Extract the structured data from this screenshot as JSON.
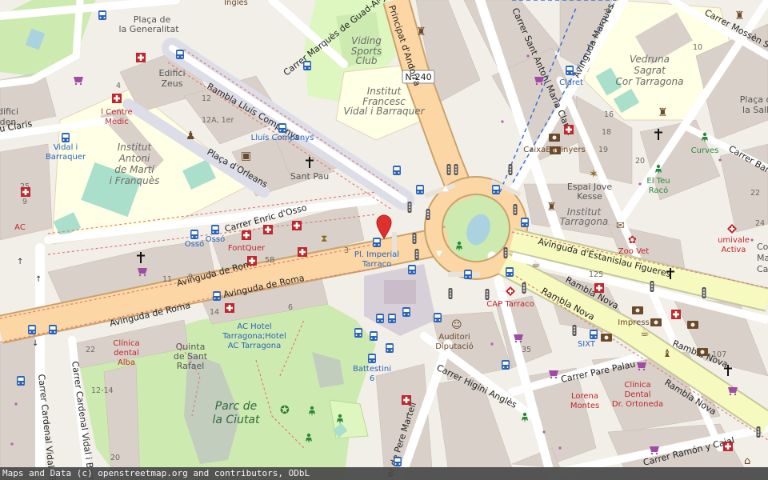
{
  "roads": {
    "principat": "Principat d'Andorra",
    "n240": "N-240",
    "marques_guadalmina": "Carrer Marquès de Guad-Al-Jarra",
    "sant_antoni": "Carrer Sant Antoni Maria Claret",
    "av_marques": "Avinguda Marquès",
    "mossen": "Carrer Mossèn Sal",
    "rambla_lluis": "Rambla Lluís Companys",
    "claris": "u Claris",
    "orleans": "Plaça d'Orleans",
    "enric_osso": "Carrer Enric d'Osso",
    "av_roma_top": "Avinguda de Roma",
    "av_roma_mid": "Avinguda de Roma",
    "av_roma_left": "Avinguda de Roma",
    "estanislau": "Avinguda d'Estanislau Figueres",
    "rambla_nova_a": "Rambla Nova",
    "rambla_nova_b": "Rambla Nova",
    "rambla_nova_c": "Rambla Nova",
    "rambla_nova_d": "Rambla Nova",
    "higini": "Carrer Higini Anglès",
    "pare_palau": "Carrer Pare Palau",
    "pere_martell": "er de Pere Martell",
    "ramon_cajal": "Carrer Ramón y Cajal",
    "cardenal_a": "Carrer Cardenal Vidal i Barr",
    "cardenal_b": "Carrer Cardenal Vidal i Bar",
    "carrer_bar": "Carrer Bar"
  },
  "areas": {
    "generalitat": [
      "Plaça de",
      "la Generalitat"
    ],
    "ingles": "Inglés",
    "viding": [
      "Viding",
      "Sports",
      "Club"
    ],
    "institut_francesc": [
      "Institut",
      "Francesc",
      "Vidal i Barraquer"
    ],
    "vedruna": [
      "Vedruna",
      "Sagrat",
      "Cor Tarragona"
    ],
    "placa_salle": [
      "Plaça de",
      "la Salle"
    ],
    "edifici_zeus": [
      "Edifici",
      "Zeus"
    ],
    "edifici": [
      "difici",
      "den"
    ],
    "institut_antoni": [
      "Institut",
      "Antoni",
      "de Martí",
      "i Franquès"
    ],
    "espai_jove": [
      "Espai Jove",
      "Kesse"
    ],
    "institut_tarragona": [
      "Institut",
      "Tarragona"
    ],
    "quinta": [
      "Quinta",
      "de Sant",
      "Rafael"
    ],
    "parc": [
      "Parc de",
      "la Ciutat"
    ],
    "sant_pau": "Sant Pau"
  },
  "pois": {
    "claret": "Claret",
    "centre_medic": [
      "l Centre",
      "Mèdic"
    ],
    "vidal_barraquer_stop": [
      "Vidal i",
      "Barraquer"
    ],
    "lluis_companys_stop": "Lluís Companys",
    "caixa": "CaixaEnginyers",
    "curves": "Curves",
    "el_teu_raco": [
      "El Teu",
      "Racó"
    ],
    "zoo_vet": "Zoo Vet",
    "umivale": [
      "umivale",
      "Activa"
    ],
    "osso1": "Ossó",
    "osso2": "Ossó",
    "fontquer": "FontQuer",
    "imperial_tarraco": [
      "Pl. Imperial",
      "Tarraco"
    ],
    "cap_tarraco": "CAP Tarraco",
    "impress": "Impress",
    "sixt": "SIXT",
    "clinica_alba": [
      "Clínica",
      "dental",
      "Alba"
    ],
    "ac_hotel": [
      "AC Hotel",
      "Tarragona;Hotel",
      "AC Tarragona"
    ],
    "auditori": [
      "Auditori",
      "Diputació"
    ],
    "battestini": [
      "Battestini",
      "6"
    ],
    "lorena": [
      "Lorena",
      "Montes"
    ],
    "clinica_ortoneda": [
      "Clínica",
      "Dental",
      "Dr. Ortoneda"
    ],
    "ac_left": "AC",
    "colm": [
      "Col",
      "Mar",
      "Car"
    ]
  },
  "house_numbers": {
    "n4": "4",
    "n12": "12",
    "n12a": "12A, 1er",
    "n10": "10",
    "n16": "16",
    "n18": "18",
    "n19": "19",
    "n20": "20",
    "n22a": "22",
    "n24": "24",
    "n7": "7",
    "n9": "9",
    "n11": "11",
    "n5b": "5B",
    "n3": "3",
    "n6": "6",
    "n14": "14",
    "n125": "125",
    "n35": "35",
    "n107": "107",
    "n22": "22",
    "n12_14": "12-14",
    "n20b": "20",
    "n25": "25",
    "n9b": "9"
  },
  "attribution": "Maps and Data (c) openstreetmap.org and contributors, ODbL",
  "colors": {
    "background": "#f2efe9",
    "building": "#d9d0c9",
    "park": "#cdebb0",
    "pitch": "#aae0cb",
    "school": "#ffffe5",
    "primary_road": "#fcd6a4",
    "secondary_road": "#f7fabf",
    "pedestrian": "#dddde8",
    "water": "#aad3df",
    "marker": "#e0302d",
    "bus": "#2a64b8",
    "health": "#c0262b"
  }
}
